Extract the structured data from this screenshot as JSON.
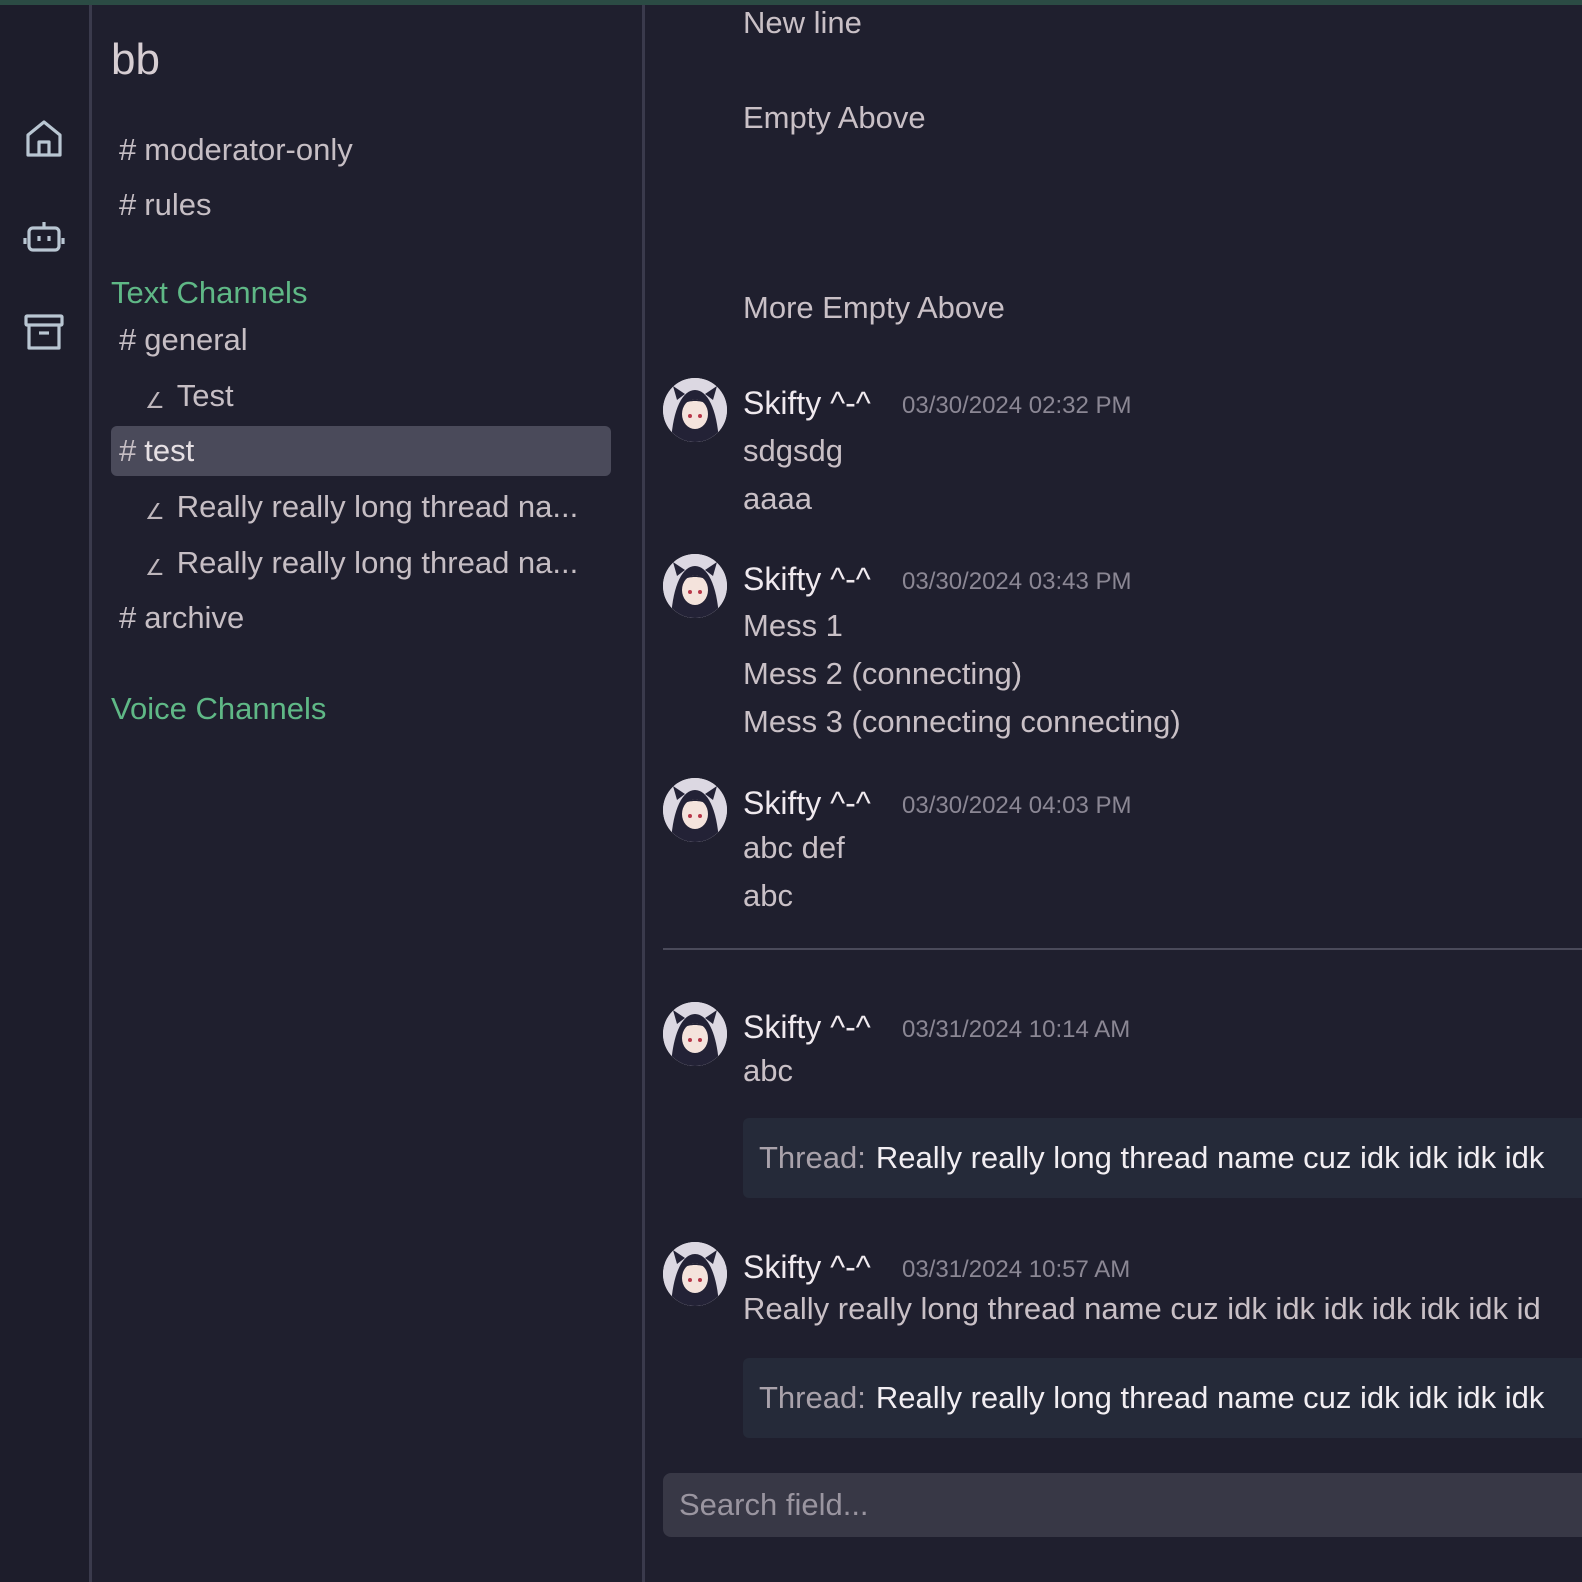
{
  "rail": {
    "icons": [
      "home-icon",
      "bot-icon",
      "archive-box-icon"
    ]
  },
  "sidebar": {
    "server_name": "bb",
    "top_channels": [
      {
        "hash": "#",
        "name": "moderator-only"
      },
      {
        "hash": "#",
        "name": "rules"
      }
    ],
    "text_category": "Text Channels",
    "text_channels": {
      "general": {
        "hash": "#",
        "name": "general"
      },
      "general_thread": {
        "glyph": "∠",
        "name": "Test"
      },
      "test": {
        "hash": "#",
        "name": "test"
      },
      "test_thread_1": {
        "glyph": "∠",
        "name": "Really really long thread na..."
      },
      "test_thread_2": {
        "glyph": "∠",
        "name": "Really really long thread na..."
      },
      "archive": {
        "hash": "#",
        "name": "archive"
      }
    },
    "voice_category": "Voice Channels"
  },
  "chat": {
    "loose_lines": [
      "New line",
      "Empty Above",
      "More Empty Above"
    ],
    "messages": [
      {
        "author": "Skifty ^-^",
        "time": "03/30/2024 02:32 PM",
        "lines": [
          "sdgsdg",
          "aaaa"
        ]
      },
      {
        "author": "Skifty ^-^",
        "time": "03/30/2024 03:43 PM",
        "lines": [
          "Mess 1",
          "Mess 2 (connecting)",
          "Mess 3 (connecting connecting)"
        ]
      },
      {
        "author": "Skifty ^-^",
        "time": "03/30/2024 04:03 PM",
        "lines": [
          "abc def",
          "abc"
        ]
      },
      {
        "author": "Skifty ^-^",
        "time": "03/31/2024 10:14 AM",
        "lines": [
          "abc"
        ],
        "thread_label": "Thread:",
        "thread_name": "Really really long thread name cuz idk idk idk idk"
      },
      {
        "author": "Skifty ^-^",
        "time": "03/31/2024 10:57 AM",
        "lines": [
          "Really really long thread name cuz idk idk idk idk idk idk id"
        ],
        "thread_label": "Thread:",
        "thread_name": "Really really long thread name cuz idk idk idk idk"
      }
    ],
    "search_placeholder": "Search field..."
  }
}
